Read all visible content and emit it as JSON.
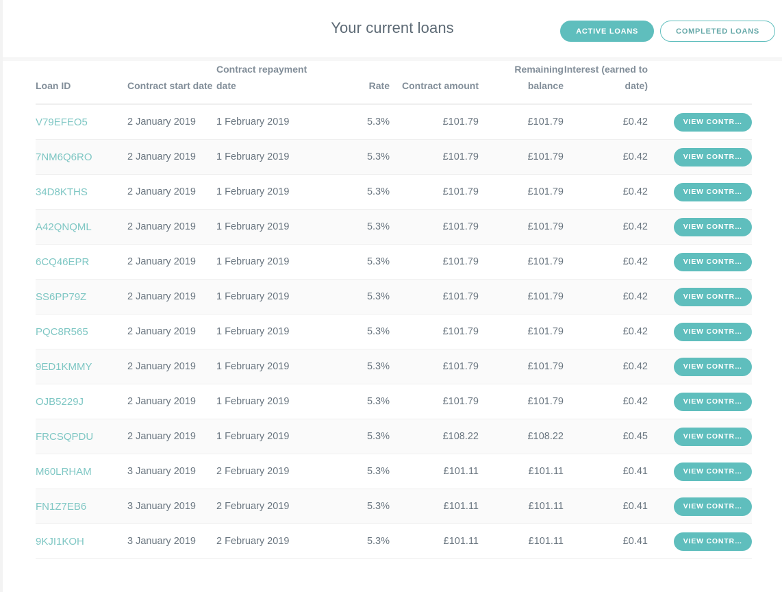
{
  "header": {
    "title": "Your current loans",
    "tabs": [
      {
        "label": "ACTIVE LOANS",
        "state": "active"
      },
      {
        "label": "COMPLETED LOANS",
        "state": "inactive"
      }
    ]
  },
  "theme": {
    "accent": "#5fbebd",
    "link": "#7fc7c4",
    "text": "#6a7680",
    "header_text": "#828e99",
    "row_alt_bg": "#fafafa",
    "border": "#efefef"
  },
  "table": {
    "columns": [
      "Loan ID",
      "Contract start date",
      "Contract repayment date",
      "Rate",
      "Contract amount",
      "Remaining balance",
      "Interest (earned to date)",
      ""
    ],
    "action_label": "VIEW CONTR…",
    "rows": [
      {
        "loan_id": "V79EFEO5",
        "start": "2 January 2019",
        "repay": "1 February 2019",
        "rate": "5.3%",
        "amount": "£101.79",
        "balance": "£101.79",
        "interest": "£0.42",
        "action": "VIEW CONTR…"
      },
      {
        "loan_id": "7NM6Q6RO",
        "start": "2 January 2019",
        "repay": "1 February 2019",
        "rate": "5.3%",
        "amount": "£101.79",
        "balance": "£101.79",
        "interest": "£0.42",
        "action": "VIEW CONTR…"
      },
      {
        "loan_id": "34D8KTHS",
        "start": "2 January 2019",
        "repay": "1 February 2019",
        "rate": "5.3%",
        "amount": "£101.79",
        "balance": "£101.79",
        "interest": "£0.42",
        "action": "VIEW CONTR…"
      },
      {
        "loan_id": "A42QNQML",
        "start": "2 January 2019",
        "repay": "1 February 2019",
        "rate": "5.3%",
        "amount": "£101.79",
        "balance": "£101.79",
        "interest": "£0.42",
        "action": "VIEW CONTR…"
      },
      {
        "loan_id": "6CQ46EPR",
        "start": "2 January 2019",
        "repay": "1 February 2019",
        "rate": "5.3%",
        "amount": "£101.79",
        "balance": "£101.79",
        "interest": "£0.42",
        "action": "VIEW CONTR…"
      },
      {
        "loan_id": "SS6PP79Z",
        "start": "2 January 2019",
        "repay": "1 February 2019",
        "rate": "5.3%",
        "amount": "£101.79",
        "balance": "£101.79",
        "interest": "£0.42",
        "action": "VIEW CONTR…"
      },
      {
        "loan_id": "PQC8R565",
        "start": "2 January 2019",
        "repay": "1 February 2019",
        "rate": "5.3%",
        "amount": "£101.79",
        "balance": "£101.79",
        "interest": "£0.42",
        "action": "VIEW CONTR…"
      },
      {
        "loan_id": "9ED1KMMY",
        "start": "2 January 2019",
        "repay": "1 February 2019",
        "rate": "5.3%",
        "amount": "£101.79",
        "balance": "£101.79",
        "interest": "£0.42",
        "action": "VIEW CONTR…"
      },
      {
        "loan_id": "OJB5229J",
        "start": "2 January 2019",
        "repay": "1 February 2019",
        "rate": "5.3%",
        "amount": "£101.79",
        "balance": "£101.79",
        "interest": "£0.42",
        "action": "VIEW CONTR…"
      },
      {
        "loan_id": "FRCSQPDU",
        "start": "2 January 2019",
        "repay": "1 February 2019",
        "rate": "5.3%",
        "amount": "£108.22",
        "balance": "£108.22",
        "interest": "£0.45",
        "action": "VIEW CONTR…"
      },
      {
        "loan_id": "M60LRHAM",
        "start": "3 January 2019",
        "repay": "2 February 2019",
        "rate": "5.3%",
        "amount": "£101.11",
        "balance": "£101.11",
        "interest": "£0.41",
        "action": "VIEW CONTR…"
      },
      {
        "loan_id": "FN1Z7EB6",
        "start": "3 January 2019",
        "repay": "2 February 2019",
        "rate": "5.3%",
        "amount": "£101.11",
        "balance": "£101.11",
        "interest": "£0.41",
        "action": "VIEW CONTR…"
      },
      {
        "loan_id": "9KJI1KOH",
        "start": "3 January 2019",
        "repay": "2 February 2019",
        "rate": "5.3%",
        "amount": "£101.11",
        "balance": "£101.11",
        "interest": "£0.41",
        "action": "VIEW CONTR…"
      }
    ]
  }
}
